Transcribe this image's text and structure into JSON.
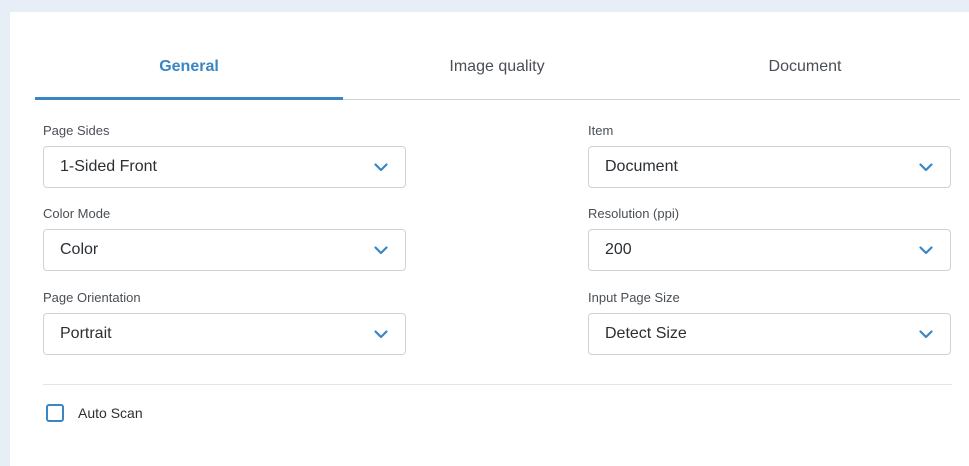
{
  "tabs": [
    {
      "label": "General",
      "active": true
    },
    {
      "label": "Image quality",
      "active": false
    },
    {
      "label": "Document",
      "active": false
    }
  ],
  "fields": {
    "page_sides": {
      "label": "Page Sides",
      "value": "1-Sided Front"
    },
    "color_mode": {
      "label": "Color Mode",
      "value": "Color"
    },
    "page_orientation": {
      "label": "Page Orientation",
      "value": "Portrait"
    },
    "item": {
      "label": "Item",
      "value": "Document"
    },
    "resolution": {
      "label": "Resolution (ppi)",
      "value": "200"
    },
    "input_page_size": {
      "label": "Input Page Size",
      "value": "Detect Size"
    }
  },
  "auto_scan": {
    "label": "Auto Scan",
    "checked": false
  },
  "colors": {
    "accent": "#3a86c4",
    "border": "#cfd3d8",
    "background": "#e8eef5"
  }
}
